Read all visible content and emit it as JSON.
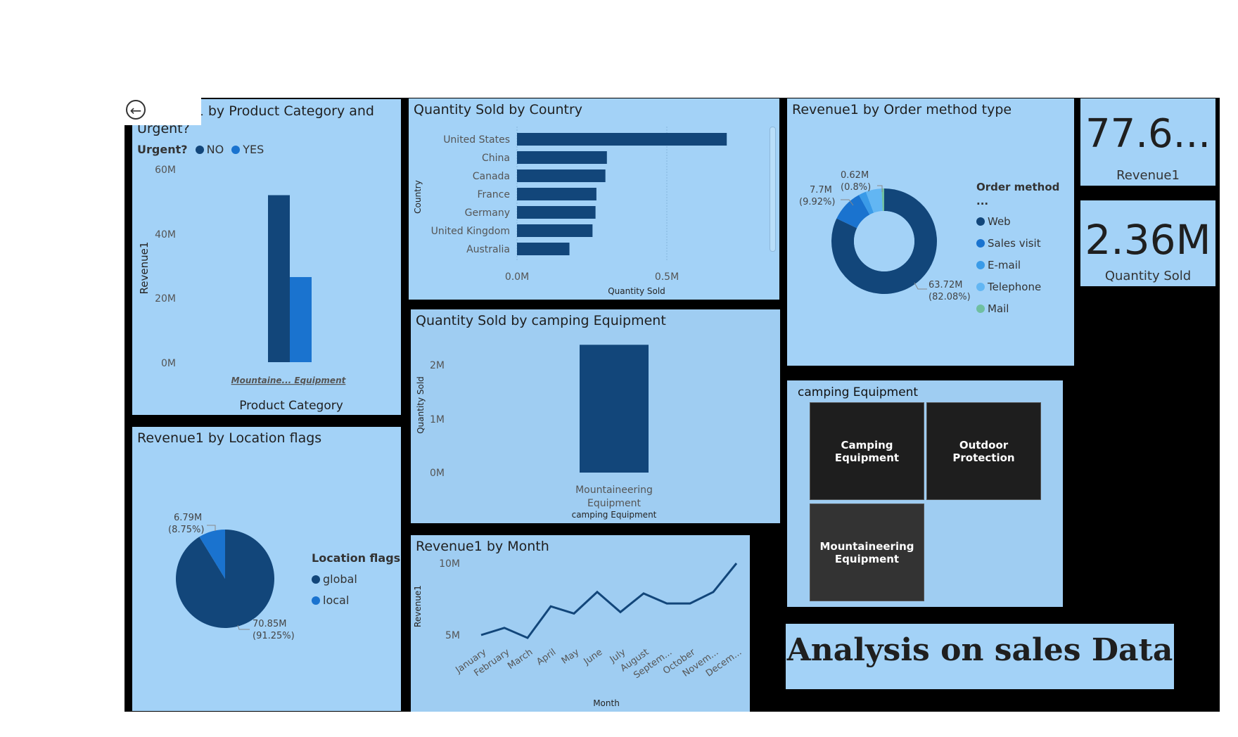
{
  "colors": {
    "dark": "#12467a",
    "mid": "#1a73cf",
    "light": "#3a9be8",
    "lighter": "#62b6f3",
    "mail": "#6fbfa0",
    "tile": "#a3d2f7",
    "canvas": "#000000"
  },
  "back_icon": "arrow-left-circle-icon",
  "charts": {
    "category_urgent": {
      "title": "Revenue1 by Product Category and Urgent?",
      "legend_title": "Urgent?",
      "legend": [
        "NO",
        "YES"
      ],
      "ylabel": "Revenue1",
      "xlabel": "Product Category",
      "yticks": [
        "60M",
        "40M",
        "20M",
        "0M"
      ],
      "category_label": "Mountaine... Equipment"
    },
    "country": {
      "title": "Quantity Sold by Country",
      "ylabel": "Country",
      "xlabel": "Quantity Sold",
      "xticks": [
        "0.0M",
        "0.5M"
      ]
    },
    "order_method": {
      "title": "Revenue1 by Order method type",
      "legend_title": "Order method ...",
      "labels": [
        "0.62M (0.8%)",
        "7.7M (9.92%)",
        "63.72M (82.08%)"
      ],
      "label_parts": {
        "a1": "0.62M",
        "a2": "(0.8%)",
        "b1": "7.7M",
        "b2": "(9.92%)",
        "c1": "63.72M",
        "c2": "(82.08%)"
      }
    },
    "kpi_revenue": {
      "value": "77.6...",
      "label": "Revenue1"
    },
    "kpi_quantity": {
      "value": "2.36M",
      "label": "Quantity Sold"
    },
    "camping": {
      "title": "Quantity Sold by camping Equipment",
      "ylabel": "Quantity Sold",
      "xlabel": "camping Equipment",
      "yticks": [
        "2M",
        "1M",
        "0M"
      ],
      "category_label_1": "Mountaineering",
      "category_label_2": "Equipment"
    },
    "location": {
      "title": "Revenue1 by Location flags",
      "legend_title": "Location flags",
      "legend": [
        "global",
        "local"
      ],
      "label_parts": {
        "a1": "6.79M",
        "a2": "(8.75%)",
        "b1": "70.85M",
        "b2": "(91.25%)"
      }
    },
    "month": {
      "title": "Revenue1 by Month",
      "ylabel": "Revenue1",
      "xlabel": "Month",
      "yticks": [
        "10M",
        "5M"
      ]
    }
  },
  "slicer": {
    "title": "camping Equipment",
    "buttons": [
      "Camping Equipment",
      "Outdoor Protection",
      "Mountaineering Equipment"
    ],
    "selected": "Mountaineering Equipment"
  },
  "report_title": "Analysis on sales Data",
  "chart_data": [
    {
      "type": "bar",
      "title": "Revenue1 by Product Category and Urgent?",
      "categories": [
        "Mountaine... Equipment"
      ],
      "series": [
        {
          "name": "NO",
          "values": [
            52
          ]
        },
        {
          "name": "YES",
          "values": [
            26.5
          ]
        }
      ],
      "units": "M",
      "xlabel": "Product Category",
      "ylabel": "Revenue1",
      "ylim": [
        0,
        60
      ]
    },
    {
      "type": "bar",
      "orientation": "horizontal",
      "title": "Quantity Sold by Country",
      "categories": [
        "United States",
        "China",
        "Canada",
        "France",
        "Germany",
        "United Kingdom",
        "Australia"
      ],
      "values": [
        0.7,
        0.3,
        0.295,
        0.265,
        0.262,
        0.252,
        0.175
      ],
      "units": "M",
      "xlabel": "Quantity Sold",
      "ylabel": "Country",
      "xlim": [
        0,
        0.85
      ]
    },
    {
      "type": "pie",
      "donut": true,
      "title": "Revenue1 by Order method type",
      "categories": [
        "Web",
        "Sales visit",
        "E-mail",
        "Telephone",
        "Mail"
      ],
      "values": [
        63.72,
        7.7,
        1.8,
        3.76,
        0.62
      ],
      "units": "M",
      "legend": "right"
    },
    {
      "type": "bar",
      "title": "Quantity Sold by camping Equipment",
      "categories": [
        "Mountaineering Equipment"
      ],
      "values": [
        2.36
      ],
      "units": "M",
      "xlabel": "camping Equipment",
      "ylabel": "Quantity Sold",
      "ylim": [
        0,
        2.4
      ]
    },
    {
      "type": "pie",
      "title": "Revenue1 by Location flags",
      "categories": [
        "global",
        "local"
      ],
      "values": [
        70.85,
        6.79
      ],
      "units": "M",
      "legend": "right"
    },
    {
      "type": "line",
      "title": "Revenue1 by Month",
      "x": [
        "January",
        "February",
        "March",
        "April",
        "May",
        "June",
        "July",
        "August",
        "Septem...",
        "October",
        "Novem...",
        "Decem..."
      ],
      "values": [
        5.0,
        5.5,
        4.8,
        7.0,
        6.5,
        8.0,
        6.6,
        7.9,
        7.2,
        7.2,
        8.0,
        10.0
      ],
      "units": "M",
      "xlabel": "Month",
      "ylabel": "Revenue1",
      "ylim": [
        2.8,
        10.8
      ]
    }
  ]
}
